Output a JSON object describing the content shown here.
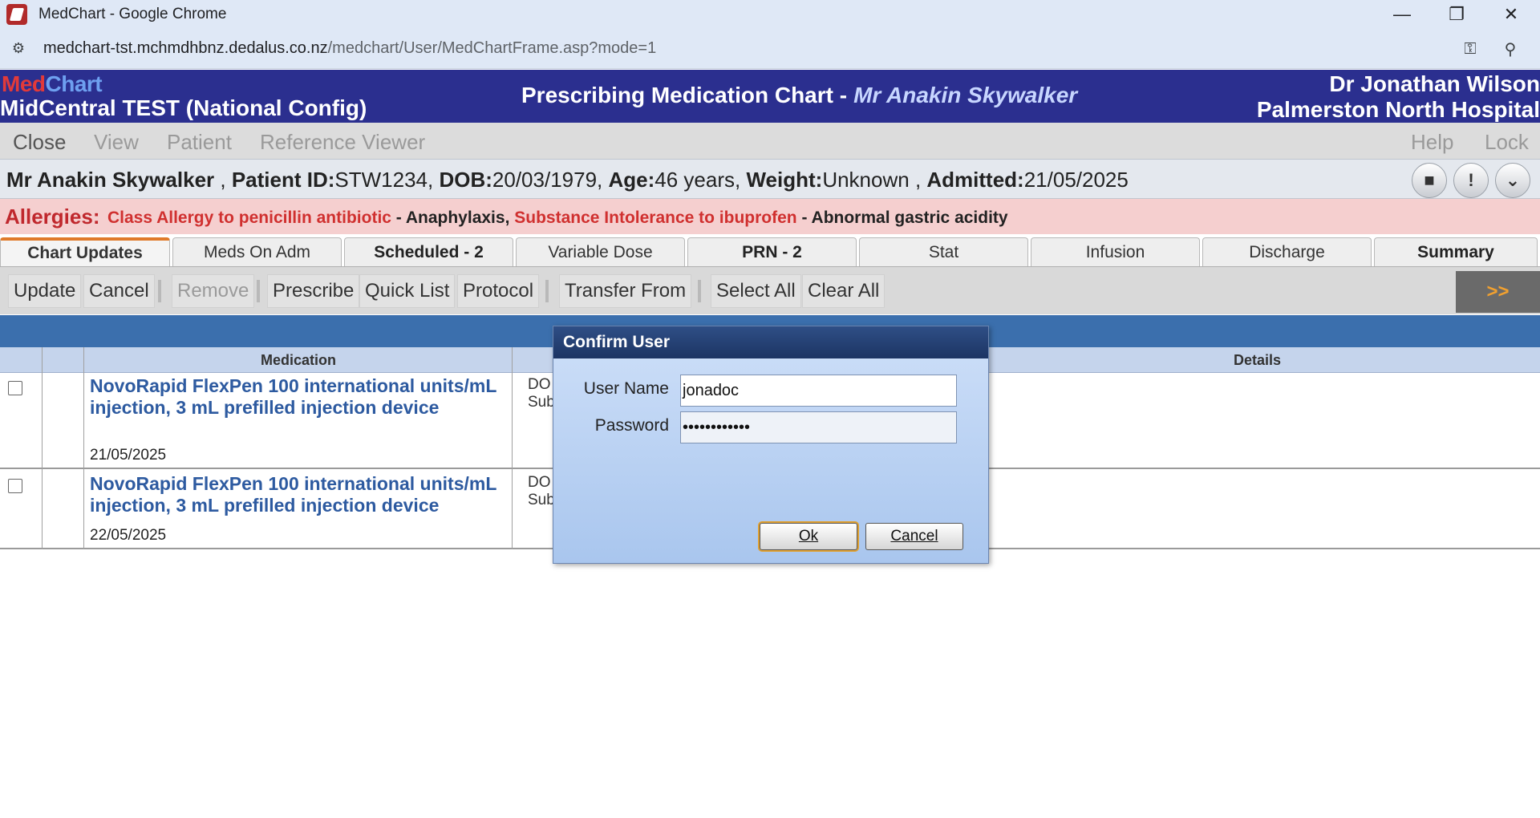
{
  "browser": {
    "window_title": "MedChart - Google Chrome",
    "url_host": "medchart-tst.mchmdhbnz.dedalus.co.nz",
    "url_path": "/medchart/User/MedChartFrame.asp?mode=1",
    "minimize_icon": "minimize-icon",
    "restore_icon": "restore-icon",
    "close_icon": "close-icon"
  },
  "header": {
    "logo_med": "Med",
    "logo_chart": "Chart",
    "site": "MidCentral TEST (National Config)",
    "chart_title": "Prescribing Medication Chart -",
    "patient_name": "Mr Anakin Skywalker",
    "doctor": "Dr Jonathan Wilson",
    "hospital": "Palmerston North Hospital"
  },
  "menu": {
    "close": "Close",
    "view": "View",
    "patient": "Patient",
    "reference_viewer": "Reference Viewer",
    "help": "Help",
    "lock": "Lock"
  },
  "patient": {
    "name": "Mr Anakin Skywalker",
    "id_label": "Patient ID:",
    "id_value": "STW1234",
    "dob_label": "DOB:",
    "dob_value": "20/03/1979",
    "age_label": "Age:",
    "age_value": "46 years",
    "weight_label": "Weight:",
    "weight_value": "Unknown",
    "admitted_label": "Admitted:",
    "admitted_value": "21/05/2025"
  },
  "allergies": {
    "label": "Allergies:",
    "items": [
      {
        "substance": "Class Allergy to penicillin antibiotic",
        "reaction": "Anaphylaxis"
      },
      {
        "substance": "Substance Intolerance to ibuprofen",
        "reaction": "Abnormal gastric acidity"
      }
    ]
  },
  "tabs": [
    {
      "label": "Chart Updates"
    },
    {
      "label": "Meds On Adm"
    },
    {
      "label": "Scheduled - 2"
    },
    {
      "label": "Variable Dose"
    },
    {
      "label": "PRN - 2"
    },
    {
      "label": "Stat"
    },
    {
      "label": "Infusion"
    },
    {
      "label": "Discharge"
    },
    {
      "label": "Summary"
    }
  ],
  "toolbar": {
    "update": "Update",
    "cancel": "Cancel",
    "remove": "Remove",
    "prescribe": "Prescribe",
    "quick_list": "Quick List",
    "protocol": "Protocol",
    "transfer_from": "Transfer From",
    "select_all": "Select All",
    "clear_all": "Clear All",
    "expand": ">>"
  },
  "grid": {
    "col_medication": "Medication",
    "col_details": "Details",
    "rows": [
      {
        "medication": "NovoRapid FlexPen 100 international units/mL injection, 3 mL prefilled injection device",
        "date": "21/05/2025",
        "dose_1": "DO",
        "dose_2": "Sub"
      },
      {
        "medication": "NovoRapid FlexPen 100 international units/mL injection, 3 mL prefilled injection device",
        "date": "22/05/2025",
        "dose_1": "DO",
        "dose_2": "Sub"
      }
    ]
  },
  "dialog": {
    "title": "Confirm User",
    "username_label": "User Name",
    "username_value": "jonadoc",
    "password_label": "Password",
    "password_value": "••••••••••••",
    "ok": "Ok",
    "cancel": "Cancel"
  }
}
